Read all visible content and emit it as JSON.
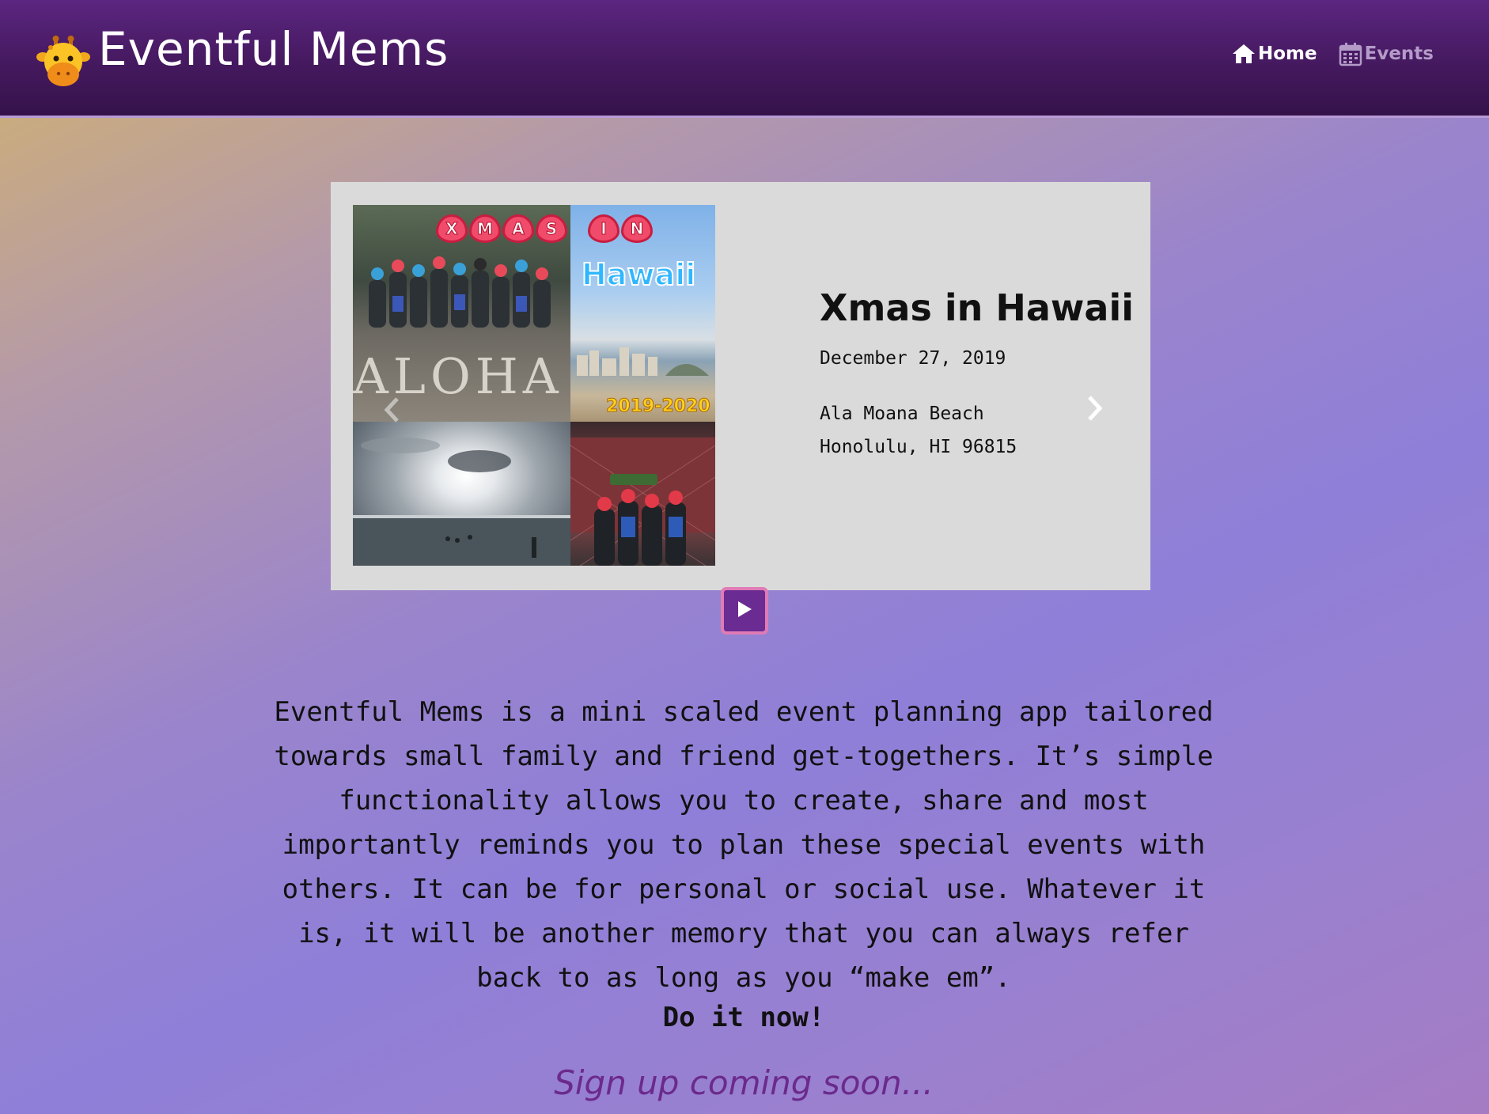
{
  "header": {
    "brand": "Eventful Mems",
    "logo_icon": "giraffe-icon",
    "nav": {
      "home_label": "Home",
      "home_icon": "home-icon",
      "events_label": "Events",
      "events_icon": "calendar-icon"
    }
  },
  "carousel": {
    "event": {
      "title": "Xmas in Hawaii",
      "date": "December 27, 2019",
      "venue": "Ala Moana Beach",
      "city": "Honolulu, HI 96815"
    },
    "image_text": {
      "hearts": [
        "X",
        "M",
        "A",
        "S",
        "I",
        "N"
      ],
      "hawaii": "Hawaii",
      "years": "2019-2020",
      "aloha": "ALOHA"
    },
    "controls": {
      "next_icon": "chevron-right-icon",
      "prev_icon": "chevron-left-icon",
      "play_icon": "play-icon"
    }
  },
  "about": {
    "text": "Eventful Mems is a mini scaled event planning app tailored towards small family and friend get-togethers. It’s simple functionality allows you to create, share and most importantly reminds you to plan these special events with others. It can be for personal or social use. Whatever it is, it will be another memory that you can always refer back to as long as you “make em”.",
    "cta": "Do it now!",
    "signup": "Sign up coming soon..."
  },
  "colors": {
    "header": "#45195f",
    "accent": "#6b2a8c",
    "play_border": "#e07bb6",
    "card": "#dadada"
  }
}
